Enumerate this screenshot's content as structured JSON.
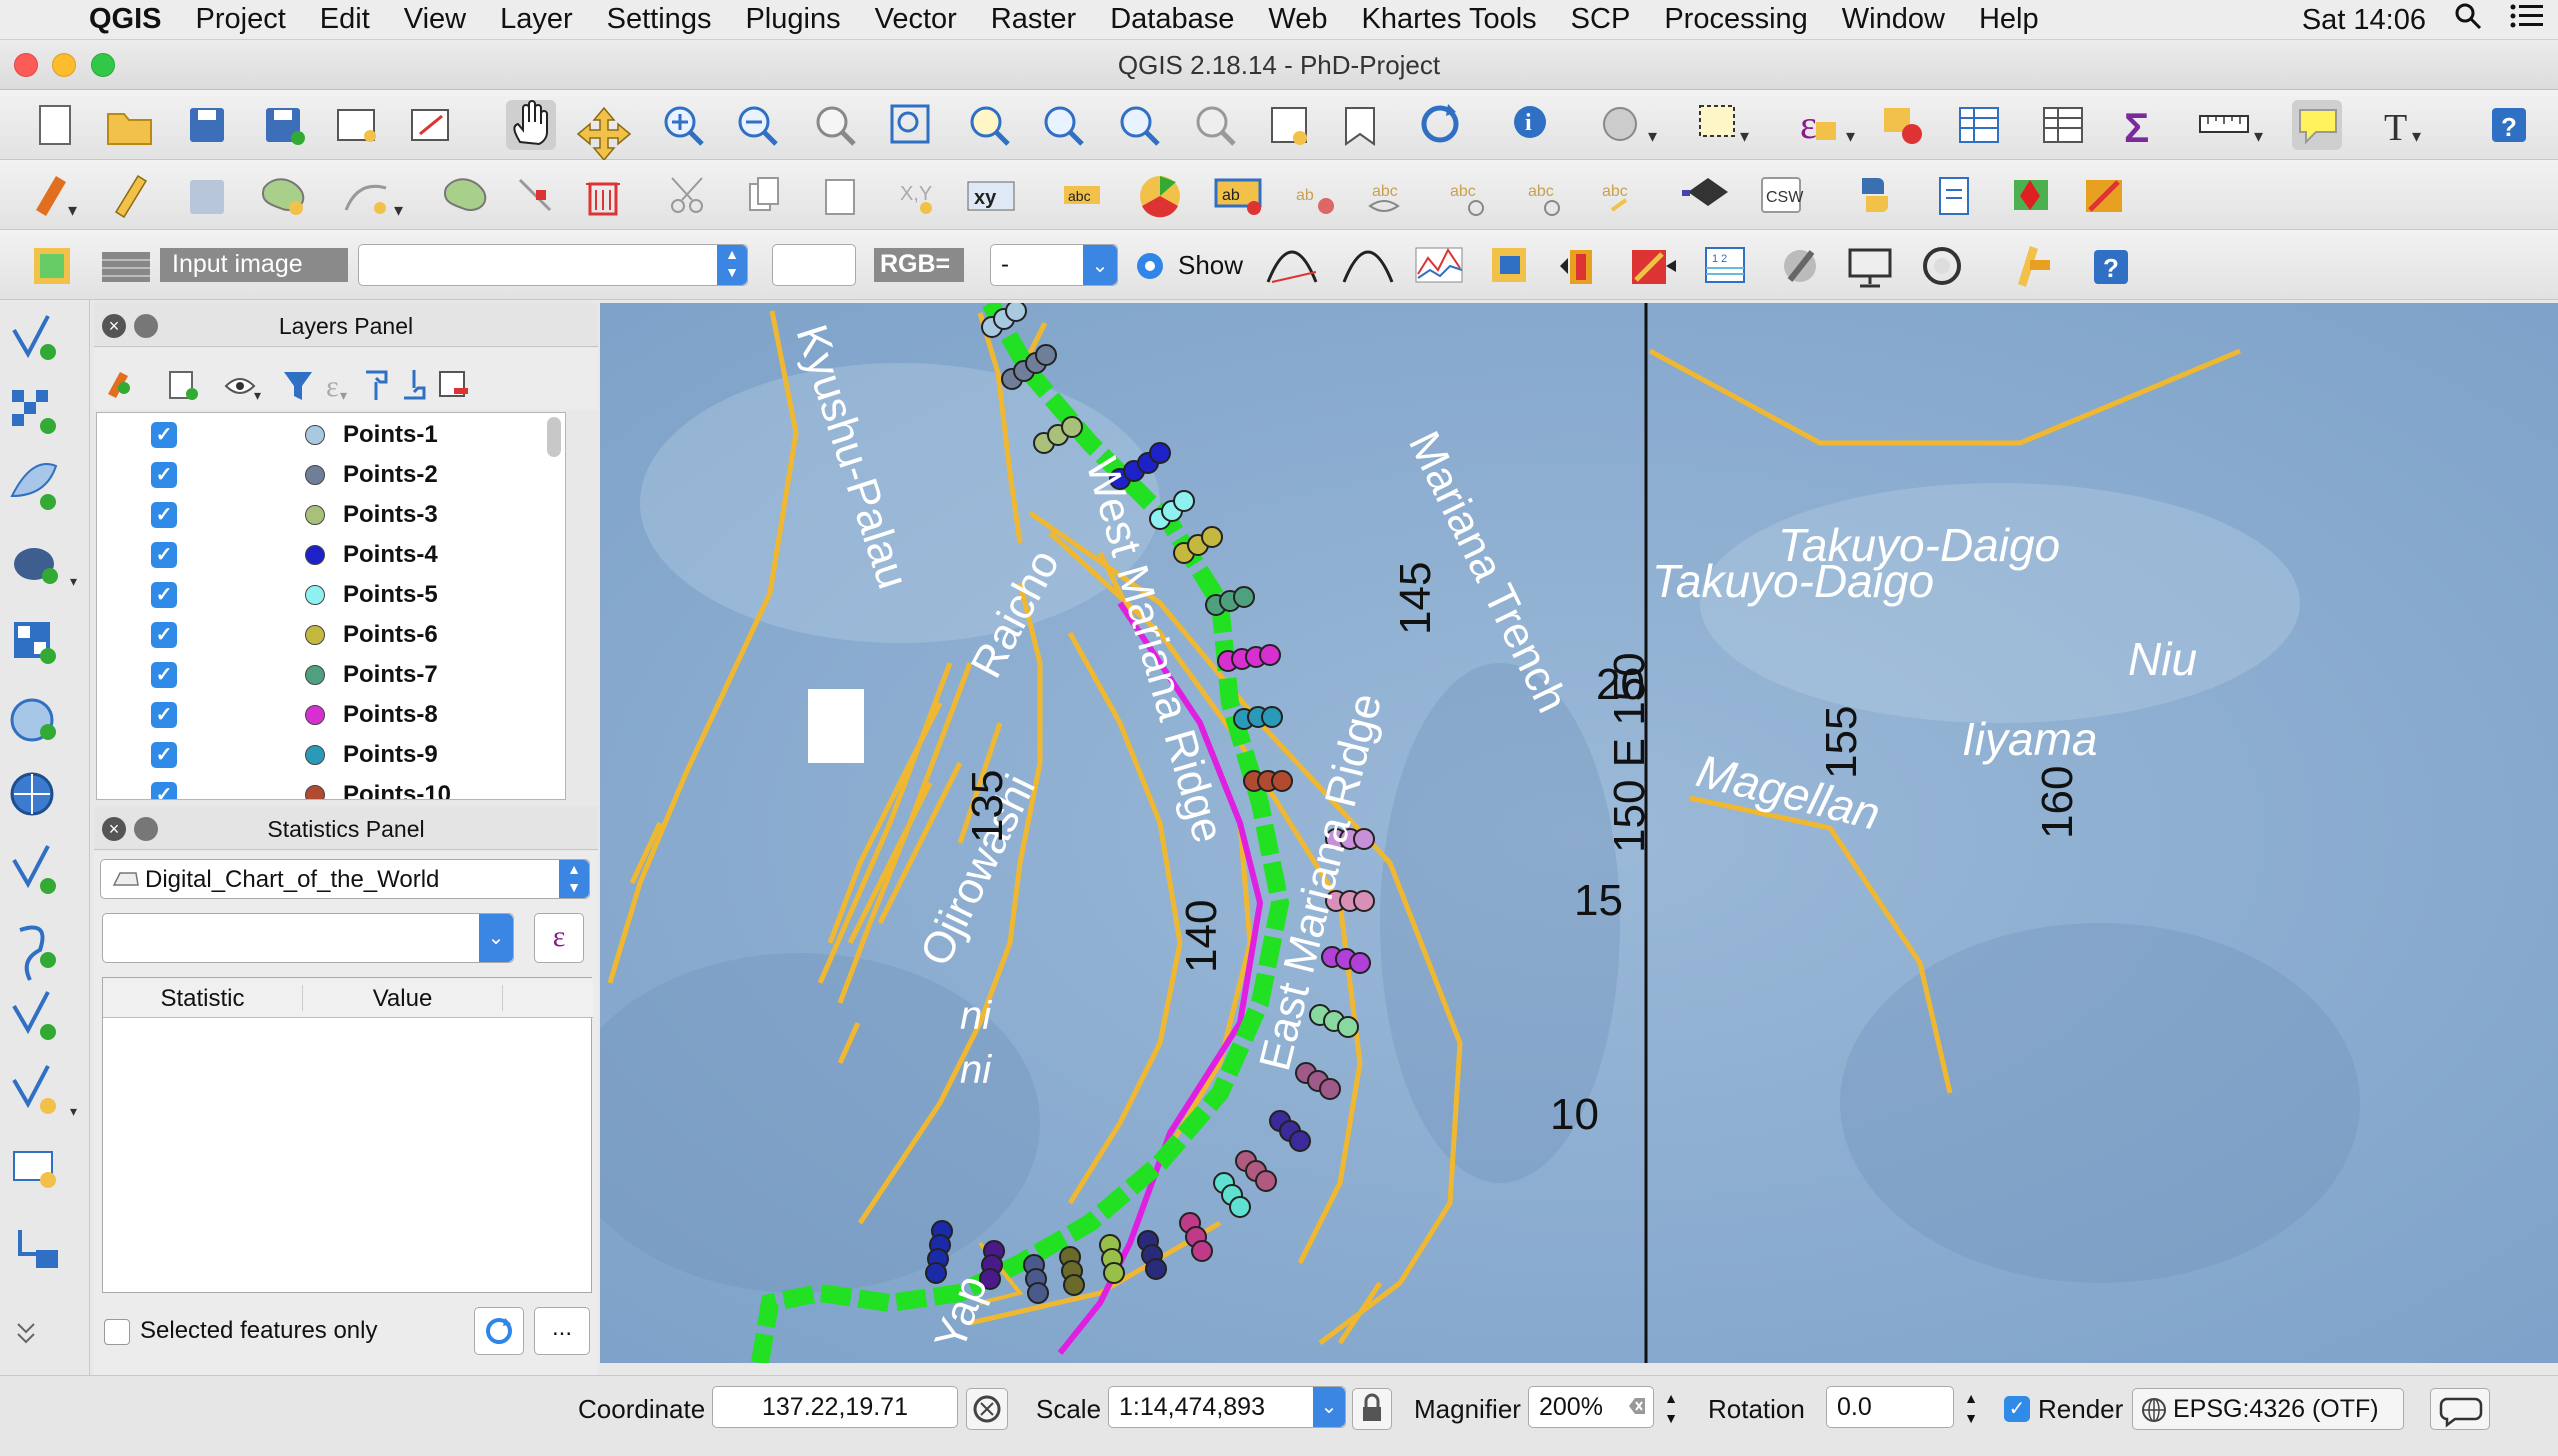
{
  "menubar": {
    "app_name": "QGIS",
    "items": [
      "Project",
      "Edit",
      "View",
      "Layer",
      "Settings",
      "Plugins",
      "Vector",
      "Raster",
      "Database",
      "Web",
      "Khartes Tools",
      "SCP",
      "Processing",
      "Window",
      "Help"
    ],
    "clock": "Sat 14:06"
  },
  "window": {
    "title": "QGIS 2.18.14 - PhD-Project"
  },
  "scp_toolbar": {
    "input_image_label": "Input image",
    "rgb_label": "RGB=",
    "rgb_value": "-",
    "show_label": "Show"
  },
  "layers_panel": {
    "title": "Layers Panel",
    "layers": [
      {
        "name": "Points-1",
        "color": "#a9c9e0"
      },
      {
        "name": "Points-2",
        "color": "#6f7f99"
      },
      {
        "name": "Points-3",
        "color": "#a9c07a"
      },
      {
        "name": "Points-4",
        "color": "#1d22c8"
      },
      {
        "name": "Points-5",
        "color": "#8ff0f0"
      },
      {
        "name": "Points-6",
        "color": "#c4b83e"
      },
      {
        "name": "Points-7",
        "color": "#4fa07e"
      },
      {
        "name": "Points-8",
        "color": "#d82fd0"
      },
      {
        "name": "Points-9",
        "color": "#2a9ab8"
      },
      {
        "name": "Points-10",
        "color": "#b04a30"
      }
    ]
  },
  "statistics_panel": {
    "title": "Statistics Panel",
    "layer_selected": "Digital_Chart_of_the_World",
    "expression_icon": "ε",
    "columns": [
      "Statistic",
      "Value"
    ],
    "selected_only_label": "Selected features only",
    "more_button": "..."
  },
  "map": {
    "labels": {
      "kyushu": "Kyushu-Palau",
      "raicho": "Raicho",
      "ojirowashi": "Ojirowashi",
      "west_mariana": "West Mariana Ridge",
      "east_mariana": "East Mariana Ridge",
      "mariana_trench": "Mariana Trench",
      "yap": "Yap",
      "takuyo_1": "Takuyo-Daigo",
      "takuyo_2": "Takuyo-Daigo",
      "magellan": "Magellan",
      "iiyama": "Iiyama",
      "niu": "Niu",
      "ni_1": "ni",
      "ni_2": "ni"
    },
    "grid_labels": {
      "lon_135": "135",
      "lon_140": "140",
      "lon_145": "145",
      "lon_150": "150 E 150",
      "lon_155": "155",
      "lon_160": "160",
      "lat_20": "20",
      "lat_15": "15",
      "lat_10": "10"
    },
    "colors": {
      "ocean": "#86a9cf",
      "ridge": "#f0b830",
      "trench": "#22e022",
      "magenta": "#e020e0"
    }
  },
  "statusbar": {
    "coordinate_label": "Coordinate",
    "coordinate_value": "137.22,19.71",
    "scale_label": "Scale",
    "scale_value": "1:14,474,893",
    "magnifier_label": "Magnifier",
    "magnifier_value": "200%",
    "rotation_label": "Rotation",
    "rotation_value": "0.0",
    "render_label": "Render",
    "crs_label": "EPSG:4326 (OTF)"
  }
}
